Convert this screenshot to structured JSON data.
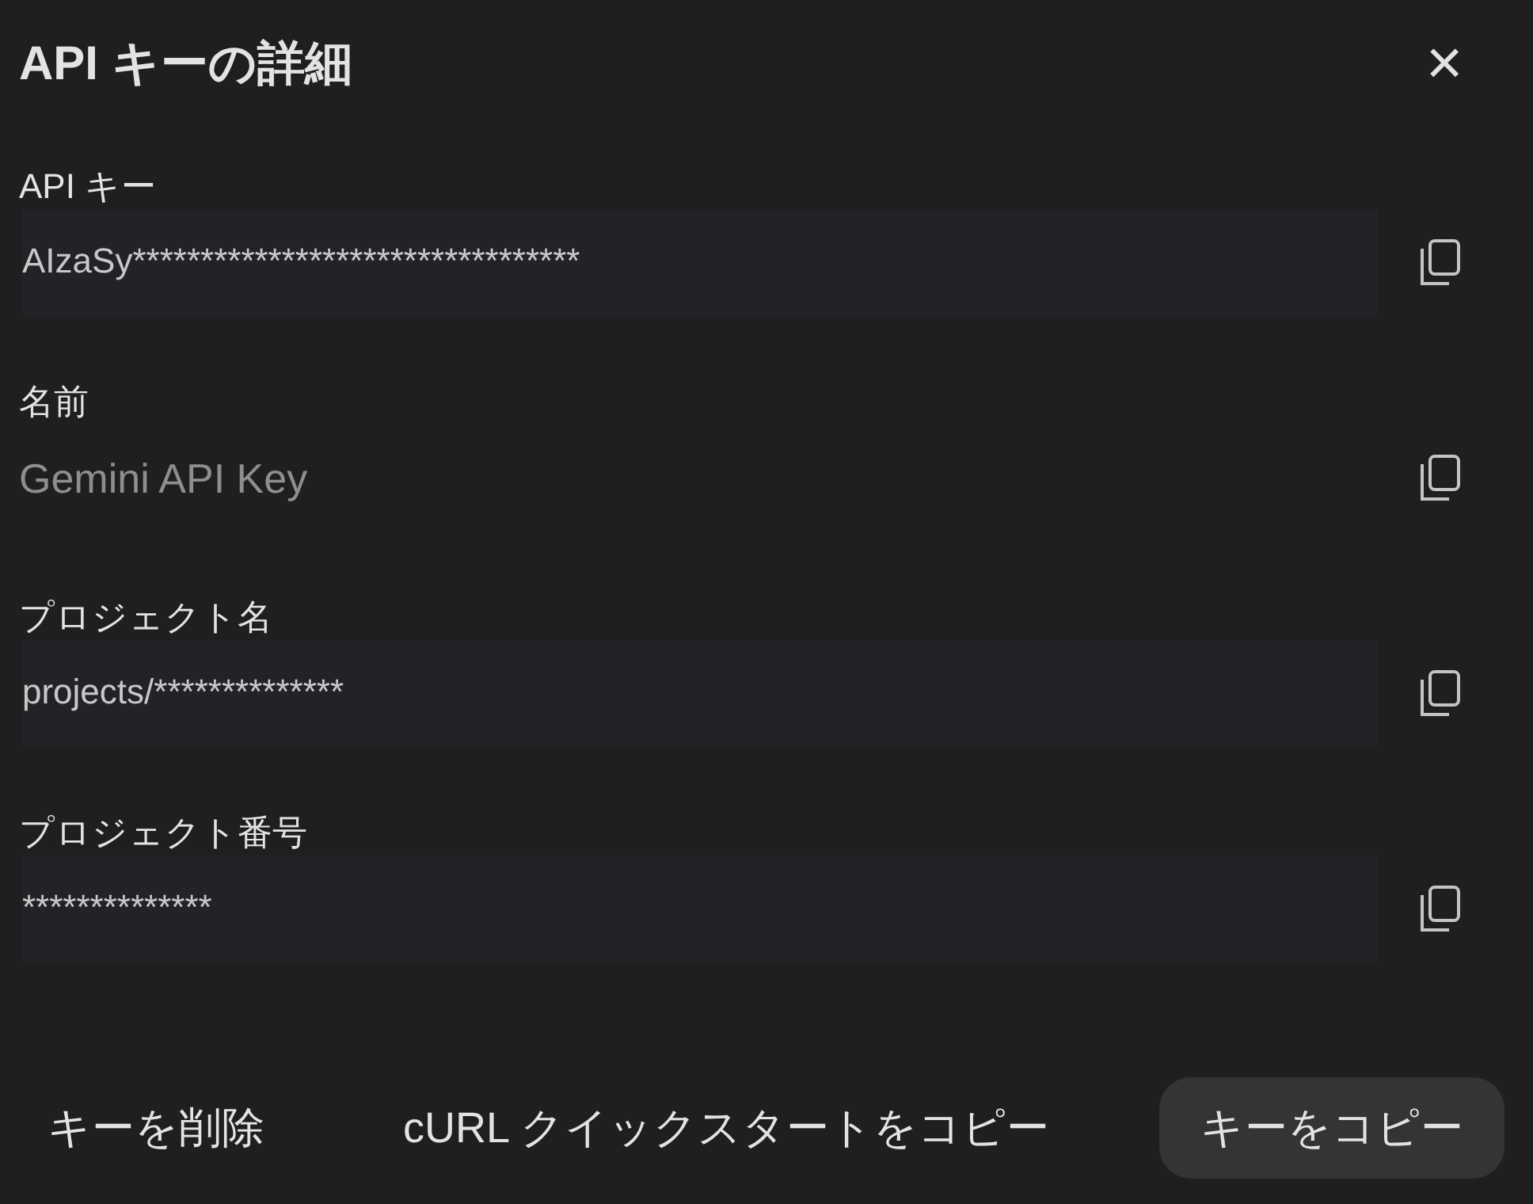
{
  "dialog": {
    "title": "API キーの詳細",
    "close": "×"
  },
  "fields": [
    {
      "kind": "boxed",
      "label": "API キー",
      "value": "AIzaSy*********************************"
    },
    {
      "kind": "plain",
      "label": "名前",
      "value": "Gemini API Key"
    },
    {
      "kind": "boxed",
      "label": "プロジェクト名",
      "value": "projects/**************"
    },
    {
      "kind": "boxed",
      "label": "プロジェクト番号",
      "value": "**************"
    }
  ],
  "actions": [
    {
      "kind": "text",
      "label": "キーを削除"
    },
    {
      "kind": "emphasis",
      "label": "cURL クイックスタートをコピー"
    },
    {
      "kind": "filled",
      "label": "キーをコピー"
    }
  ]
}
